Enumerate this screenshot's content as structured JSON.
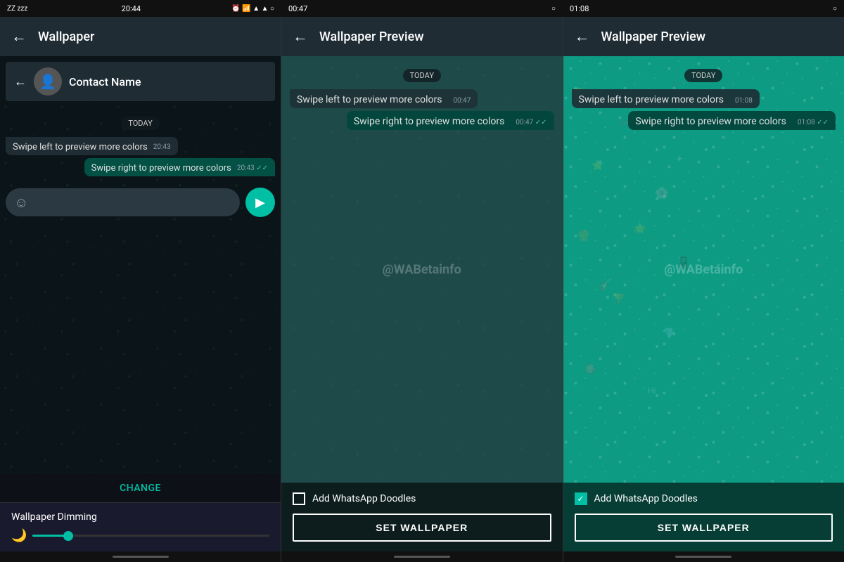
{
  "status_bars": [
    {
      "left": "ZZ",
      "time": "20:44",
      "right_icons": "alarm wifi signal signal circle"
    },
    {
      "left": "",
      "time": "00:47",
      "right_icons": "circle"
    },
    {
      "left": "",
      "time": "01:08",
      "right_icons": "circle"
    }
  ],
  "panel1": {
    "title": "Wallpaper",
    "contact_name": "Contact Name",
    "date_badge": "TODAY",
    "msg_received": "Swipe left to preview more colors",
    "msg_received_time": "20:43",
    "msg_sent": "Swipe right to preview more colors",
    "msg_sent_time": "20:43",
    "change_label": "CHANGE",
    "dimming_label": "Wallpaper Dimming"
  },
  "panel2": {
    "title": "Wallpaper Preview",
    "date_badge": "TODAY",
    "msg_received": "Swipe left to preview more colors",
    "msg_received_time": "00:47",
    "msg_sent": "Swipe right to preview more colors",
    "msg_sent_time": "00:47",
    "add_doodles_label": "Add WhatsApp Doodles",
    "doodles_checked": false,
    "set_wallpaper_label": "SET WALLPAPER"
  },
  "panel3": {
    "title": "Wallpaper Preview",
    "date_badge": "TODAY",
    "msg_received": "Swipe left to preview more colors",
    "msg_received_time": "01:08",
    "msg_sent": "Swipe right to preview more colors",
    "msg_sent_time": "01:08",
    "add_doodles_label": "Add WhatsApp Doodles",
    "doodles_checked": true,
    "set_wallpaper_label": "SET WALLPAPER"
  },
  "watermark": "@WABetainfo",
  "icons": {
    "back_arrow": "←",
    "send": "▶",
    "emoji": "☺",
    "moon": "🌙",
    "check": "✓",
    "double_check": "✓✓",
    "avatar": "👤"
  }
}
